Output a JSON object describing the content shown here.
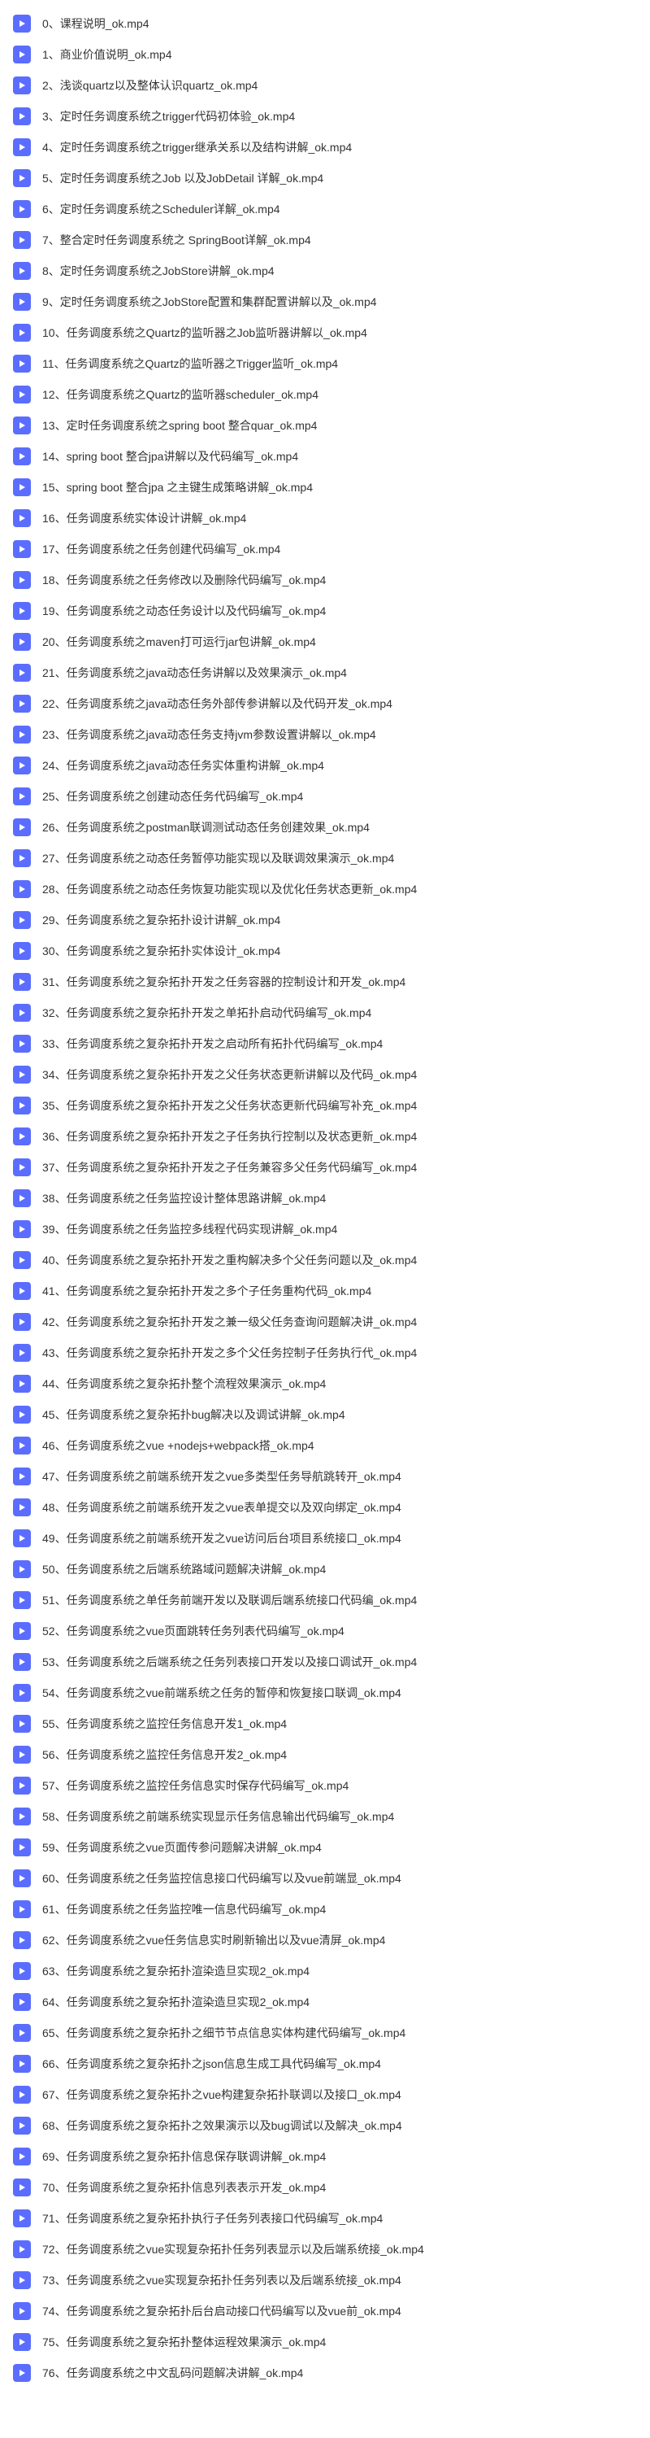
{
  "videos": [
    {
      "index": 0,
      "title": "课程说明_ok.mp4"
    },
    {
      "index": 1,
      "title": "商业价值说明_ok.mp4"
    },
    {
      "index": 2,
      "title": "浅谈quartz以及整体认识quartz_ok.mp4"
    },
    {
      "index": 3,
      "title": "定时任务调度系统之trigger代码初体验_ok.mp4"
    },
    {
      "index": 4,
      "title": "定时任务调度系统之trigger继承关系以及结构讲解_ok.mp4"
    },
    {
      "index": 5,
      "title": "定时任务调度系统之Job 以及JobDetail 详解_ok.mp4"
    },
    {
      "index": 6,
      "title": "定时任务调度系统之Scheduler详解_ok.mp4"
    },
    {
      "index": 7,
      "title": "整合定时任务调度系统之 SpringBoot详解_ok.mp4"
    },
    {
      "index": 8,
      "title": "定时任务调度系统之JobStore讲解_ok.mp4"
    },
    {
      "index": 9,
      "title": "定时任务调度系统之JobStore配置和集群配置讲解以及_ok.mp4"
    },
    {
      "index": 10,
      "title": "任务调度系统之Quartz的监听器之Job监听器讲解以_ok.mp4"
    },
    {
      "index": 11,
      "title": "任务调度系统之Quartz的监听器之Trigger监听_ok.mp4"
    },
    {
      "index": 12,
      "title": "任务调度系统之Quartz的监听器scheduler_ok.mp4"
    },
    {
      "index": 13,
      "title": "定时任务调度系统之spring boot 整合quar_ok.mp4"
    },
    {
      "index": 14,
      "title": "spring boot 整合jpa讲解以及代码编写_ok.mp4"
    },
    {
      "index": 15,
      "title": "spring boot 整合jpa 之主键生成策略讲解_ok.mp4"
    },
    {
      "index": 16,
      "title": "任务调度系统实体设计讲解_ok.mp4"
    },
    {
      "index": 17,
      "title": "任务调度系统之任务创建代码编写_ok.mp4"
    },
    {
      "index": 18,
      "title": "任务调度系统之任务修改以及删除代码编写_ok.mp4"
    },
    {
      "index": 19,
      "title": "任务调度系统之动态任务设计以及代码编写_ok.mp4"
    },
    {
      "index": 20,
      "title": "任务调度系统之maven打可运行jar包讲解_ok.mp4"
    },
    {
      "index": 21,
      "title": "任务调度系统之java动态任务讲解以及效果演示_ok.mp4"
    },
    {
      "index": 22,
      "title": "任务调度系统之java动态任务外部传参讲解以及代码开发_ok.mp4"
    },
    {
      "index": 23,
      "title": "任务调度系统之java动态任务支持jvm参数设置讲解以_ok.mp4"
    },
    {
      "index": 24,
      "title": "任务调度系统之java动态任务实体重构讲解_ok.mp4"
    },
    {
      "index": 25,
      "title": "任务调度系统之创建动态任务代码编写_ok.mp4"
    },
    {
      "index": 26,
      "title": "任务调度系统之postman联调测试动态任务创建效果_ok.mp4"
    },
    {
      "index": 27,
      "title": "任务调度系统之动态任务暂停功能实现以及联调效果演示_ok.mp4"
    },
    {
      "index": 28,
      "title": "任务调度系统之动态任务恢复功能实现以及优化任务状态更新_ok.mp4"
    },
    {
      "index": 29,
      "title": "任务调度系统之复杂拓扑设计讲解_ok.mp4"
    },
    {
      "index": 30,
      "title": "任务调度系统之复杂拓扑实体设计_ok.mp4"
    },
    {
      "index": 31,
      "title": "任务调度系统之复杂拓扑开发之任务容器的控制设计和开发_ok.mp4"
    },
    {
      "index": 32,
      "title": "任务调度系统之复杂拓扑开发之单拓扑启动代码编写_ok.mp4"
    },
    {
      "index": 33,
      "title": "任务调度系统之复杂拓扑开发之启动所有拓扑代码编写_ok.mp4"
    },
    {
      "index": 34,
      "title": "任务调度系统之复杂拓扑开发之父任务状态更新讲解以及代码_ok.mp4"
    },
    {
      "index": 35,
      "title": "任务调度系统之复杂拓扑开发之父任务状态更新代码编写补充_ok.mp4"
    },
    {
      "index": 36,
      "title": "任务调度系统之复杂拓扑开发之子任务执行控制以及状态更新_ok.mp4"
    },
    {
      "index": 37,
      "title": "任务调度系统之复杂拓扑开发之子任务兼容多父任务代码编写_ok.mp4"
    },
    {
      "index": 38,
      "title": "任务调度系统之任务监控设计整体思路讲解_ok.mp4"
    },
    {
      "index": 39,
      "title": "任务调度系统之任务监控多线程代码实现讲解_ok.mp4"
    },
    {
      "index": 40,
      "title": "任务调度系统之复杂拓扑开发之重构解决多个父任务问题以及_ok.mp4"
    },
    {
      "index": 41,
      "title": "任务调度系统之复杂拓扑开发之多个子任务重构代码_ok.mp4"
    },
    {
      "index": 42,
      "title": "任务调度系统之复杂拓扑开发之兼一级父任务查询问题解决讲_ok.mp4"
    },
    {
      "index": 43,
      "title": "任务调度系统之复杂拓扑开发之多个父任务控制子任务执行代_ok.mp4"
    },
    {
      "index": 44,
      "title": "任务调度系统之复杂拓扑整个流程效果演示_ok.mp4"
    },
    {
      "index": 45,
      "title": "任务调度系统之复杂拓扑bug解决以及调试讲解_ok.mp4"
    },
    {
      "index": 46,
      "title": "任务调度系统之vue +nodejs+webpack搭_ok.mp4"
    },
    {
      "index": 47,
      "title": "任务调度系统之前端系统开发之vue多类型任务导航跳转开_ok.mp4"
    },
    {
      "index": 48,
      "title": "任务调度系统之前端系统开发之vue表单提交以及双向绑定_ok.mp4"
    },
    {
      "index": 49,
      "title": "任务调度系统之前端系统开发之vue访问后台项目系统接口_ok.mp4"
    },
    {
      "index": 50,
      "title": "任务调度系统之后端系统路域问题解决讲解_ok.mp4"
    },
    {
      "index": 51,
      "title": "任务调度系统之单任务前端开发以及联调后端系统接口代码编_ok.mp4"
    },
    {
      "index": 52,
      "title": "任务调度系统之vue页面跳转任务列表代码编写_ok.mp4"
    },
    {
      "index": 53,
      "title": "任务调度系统之后端系统之任务列表接口开发以及接口调试开_ok.mp4"
    },
    {
      "index": 54,
      "title": "任务调度系统之vue前端系统之任务的暂停和恢复接口联调_ok.mp4"
    },
    {
      "index": 55,
      "title": "任务调度系统之监控任务信息开发1_ok.mp4"
    },
    {
      "index": 56,
      "title": "任务调度系统之监控任务信息开发2_ok.mp4"
    },
    {
      "index": 57,
      "title": "任务调度系统之监控任务信息实时保存代码编写_ok.mp4"
    },
    {
      "index": 58,
      "title": "任务调度系统之前端系统实现显示任务信息输出代码编写_ok.mp4"
    },
    {
      "index": 59,
      "title": "任务调度系统之vue页面传参问题解决讲解_ok.mp4"
    },
    {
      "index": 60,
      "title": "任务调度系统之任务监控信息接口代码编写以及vue前端显_ok.mp4"
    },
    {
      "index": 61,
      "title": "任务调度系统之任务监控唯一信息代码编写_ok.mp4"
    },
    {
      "index": 62,
      "title": "任务调度系统之vue任务信息实时刷新输出以及vue清屏_ok.mp4"
    },
    {
      "index": 63,
      "title": "任务调度系统之复杂拓扑渲染造旦实现2_ok.mp4"
    },
    {
      "index": 64,
      "title": "任务调度系统之复杂拓扑渲染造旦实现2_ok.mp4"
    },
    {
      "index": 65,
      "title": "任务调度系统之复杂拓扑之细节节点信息实体构建代码编写_ok.mp4"
    },
    {
      "index": 66,
      "title": "任务调度系统之复杂拓扑之json信息生成工具代码编写_ok.mp4"
    },
    {
      "index": 67,
      "title": "任务调度系统之复杂拓扑之vue构建复杂拓扑联调以及接口_ok.mp4"
    },
    {
      "index": 68,
      "title": "任务调度系统之复杂拓扑之效果演示以及bug调试以及解决_ok.mp4"
    },
    {
      "index": 69,
      "title": "任务调度系统之复杂拓扑信息保存联调讲解_ok.mp4"
    },
    {
      "index": 70,
      "title": "任务调度系统之复杂拓扑信息列表表示开发_ok.mp4"
    },
    {
      "index": 71,
      "title": "任务调度系统之复杂拓扑执行子任务列表接口代码编写_ok.mp4"
    },
    {
      "index": 72,
      "title": "任务调度系统之vue实现复杂拓扑任务列表显示以及后端系统接_ok.mp4"
    },
    {
      "index": 73,
      "title": "任务调度系统之vue实现复杂拓扑任务列表以及后端系统接_ok.mp4"
    },
    {
      "index": 74,
      "title": "任务调度系统之复杂拓扑后台启动接口代码编写以及vue前_ok.mp4"
    },
    {
      "index": 75,
      "title": "任务调度系统之复杂拓扑整体运程效果演示_ok.mp4"
    },
    {
      "index": 76,
      "title": "任务调度系统之中文乱码问题解决讲解_ok.mp4"
    }
  ]
}
